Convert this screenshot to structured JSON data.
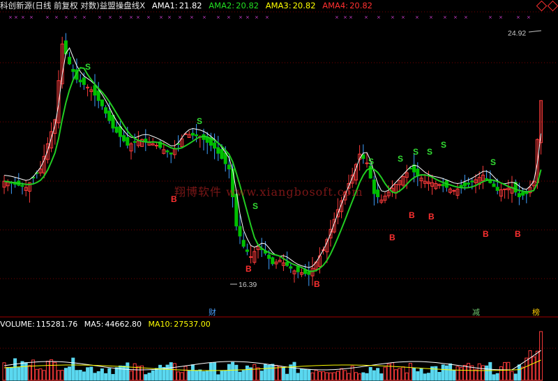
{
  "header": {
    "stock": "科创新源",
    "period": "(日线 前复权 对数)",
    "indicator": "益盟操盘线X",
    "ama1_label": "AMA1:",
    "ama1_value": "21.82",
    "ama2_label": "AMA2:",
    "ama2_value": "20.82",
    "ama3_label": "AMA3:",
    "ama3_value": "20.82",
    "ama4_label": "AMA4:",
    "ama4_value": "20.82"
  },
  "price_labels": {
    "high": "24.92",
    "low": "16.39"
  },
  "watermark": "翔博软件 www.xiangbosoft.com",
  "events": [
    {
      "text": "财",
      "color": "#4aa0ff"
    },
    {
      "text": "减",
      "color": "#6fc86f"
    },
    {
      "text": "榜",
      "color": "#ffcc00"
    }
  ],
  "signals": {
    "S": "S",
    "B": "B"
  },
  "volume_header": {
    "volume_label": "VOLUME:",
    "volume_value": "115281.76",
    "ma5_label": "MA5:",
    "ma5_value": "44662.80",
    "ma10_label": "MA10:",
    "ma10_value": "27537.00"
  },
  "colors": {
    "up": "#ff3b3b",
    "down": "#00c000",
    "ama_green": "#22cc22",
    "ama_yellow": "#ffff00",
    "ama_red": "#ff2020",
    "ma_white": "#ffffff",
    "vol_bar": "#5ad8f0",
    "grid": "#7a0000"
  },
  "chart_data": {
    "type": "candlestick",
    "title": "",
    "ylim": [
      16.39,
      24.92
    ],
    "candles": [],
    "note_high": 24.92,
    "note_low": 16.39
  }
}
